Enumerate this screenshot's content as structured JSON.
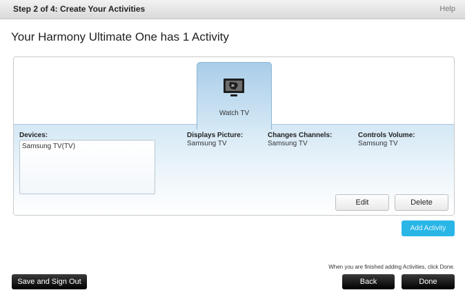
{
  "header": {
    "step": "Step 2 of 4: Create Your Activities",
    "help": "Help"
  },
  "page_title": "Your Harmony Ultimate One has 1 Activity",
  "activity_tab": {
    "label": "Watch TV",
    "icon": "tv-icon"
  },
  "details": {
    "devices_heading": "Devices:",
    "devices": [
      "Samsung TV(TV)"
    ],
    "displays_picture_heading": "Displays Picture:",
    "displays_picture_value": "Samsung TV",
    "changes_channels_heading": "Changes Channels:",
    "changes_channels_value": "Samsung TV",
    "controls_volume_heading": "Controls Volume:",
    "controls_volume_value": "Samsung TV"
  },
  "actions": {
    "edit": "Edit",
    "delete": "Delete",
    "add_activity": "Add Activity"
  },
  "footer": {
    "hint": "When you are finished adding Activities, click Done.",
    "save_sign_out": "Save and Sign Out",
    "back": "Back",
    "done": "Done"
  },
  "colors": {
    "accent_blue": "#29b6e7",
    "tab_blue": "#a9cde8",
    "dark_button": "#111111"
  }
}
